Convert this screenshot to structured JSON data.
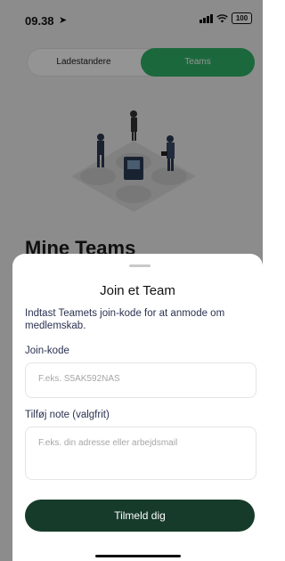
{
  "status": {
    "time": "09.38",
    "battery": "100"
  },
  "segments": {
    "left": "Ladestandere",
    "right": "Teams",
    "active": "Teams"
  },
  "background": {
    "heading": "Mine Teams"
  },
  "sheet": {
    "title": "Join et Team",
    "description": "Indtast Teamets join-kode for at anmode om medlemskab.",
    "code_label": "Join-kode",
    "code_placeholder": "F.eks. S5AK592NAS",
    "note_label": "Tilføj note (valgfrit)",
    "note_placeholder": "F.eks. din adresse eller arbejdsmail",
    "submit_label": "Tilmeld dig"
  },
  "colors": {
    "accent": "#2fb368",
    "button": "#173b2a",
    "text_dark": "#2a3150"
  }
}
